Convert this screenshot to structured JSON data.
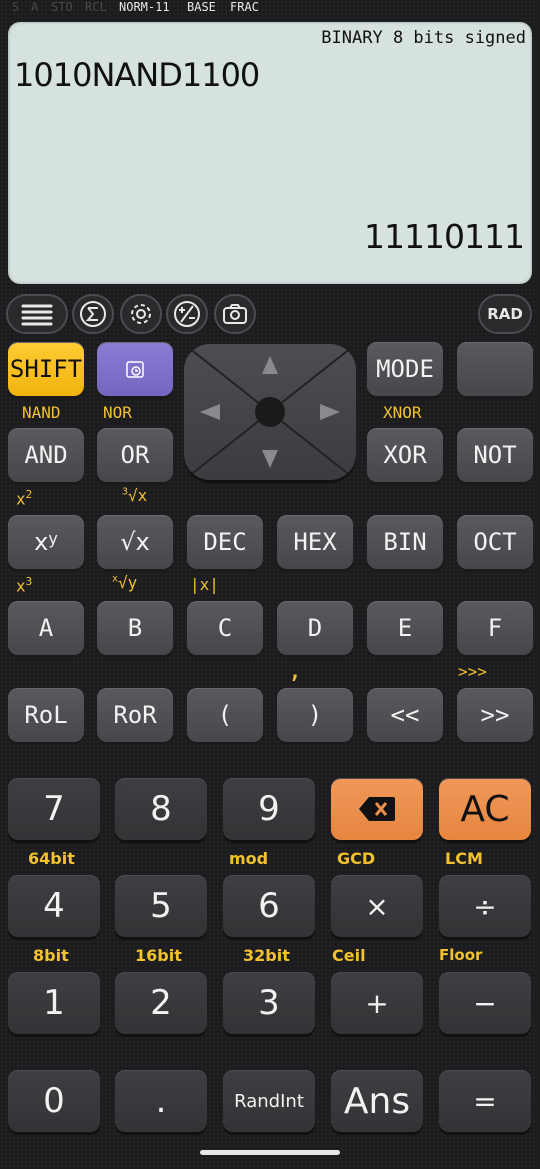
{
  "status": {
    "dim_items": [
      "S",
      "A",
      "STO",
      "RCL"
    ],
    "items": [
      "NORM-11",
      "BASE",
      "FRAC"
    ]
  },
  "display": {
    "mode": "BINARY 8 bits signed",
    "expression": "1010NAND1100",
    "result": "11110111"
  },
  "toolbar": {
    "menu_icon": "hamburger-icon",
    "sigma_icon": "sigma-icon",
    "settings_icon": "gear-icon",
    "plus_minus_icon": "plus-minus-icon",
    "camera_icon": "camera-icon",
    "angle_label": "RAD"
  },
  "keys": {
    "shift": "SHIFT",
    "mode": "MODE",
    "and": "AND",
    "or": "OR",
    "xor": "XOR",
    "not": "NOT",
    "dec": "DEC",
    "hex": "HEX",
    "bin": "BIN",
    "oct": "OCT",
    "a": "A",
    "b": "B",
    "c": "C",
    "d": "D",
    "e": "E",
    "f": "F",
    "rol": "RoL",
    "ror": "RoR",
    "lparen": "(",
    "rparen": ")",
    "shl": "<<",
    "shr": ">>",
    "n7": "7",
    "n8": "8",
    "n9": "9",
    "ac": "AC",
    "n4": "4",
    "n5": "5",
    "n6": "6",
    "mul": "×",
    "div": "÷",
    "n1": "1",
    "n2": "2",
    "n3": "3",
    "plus": "+",
    "minus": "−",
    "n0": "0",
    "dot": ".",
    "randint": "RandInt",
    "ans": "Ans",
    "eq": "="
  },
  "shift_labels": {
    "nand": "NAND",
    "nor": "NOR",
    "xnor": "XNOR",
    "abs": "|x|",
    "comma": ",",
    "ushr": ">>>",
    "b64": "64bit",
    "mod": "mod",
    "gcd": "GCD",
    "lcm": "LCM",
    "b8": "8bit",
    "b16": "16bit",
    "b32": "32bit",
    "ceil": "Ceil",
    "floor": "Floor"
  },
  "colors": {
    "display_bg": "#d6e2e0",
    "shift_key": "#f7bf1f",
    "orange_key": "#ec8f4c",
    "purple_key": "#7f70c9",
    "shift_label": "#f2c12e"
  }
}
